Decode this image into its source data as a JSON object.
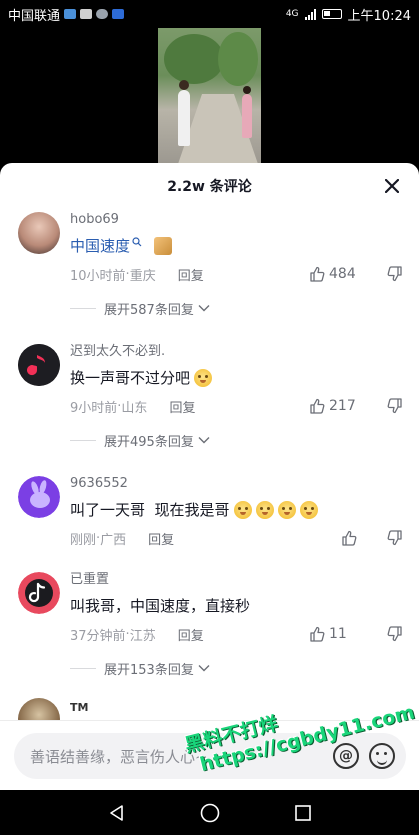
{
  "status_bar": {
    "carrier": "中国联通",
    "network": "4G",
    "time": "上午10:24"
  },
  "sheet": {
    "title": "2.2w 条评论",
    "close_icon": "close-icon"
  },
  "comments": [
    {
      "username": "hobo69",
      "text": "中国速度",
      "text_is_link": true,
      "has_search_icon": true,
      "time": "10小时前",
      "location": "重庆",
      "reply_label": "回复",
      "likes": "484",
      "expand_label": "展开587条回复"
    },
    {
      "username": "迟到太久不必到.",
      "text": "换一声哥不过分吧",
      "emoji_count": 1,
      "time": "9小时前",
      "location": "山东",
      "reply_label": "回复",
      "likes": "217",
      "expand_label": "展开495条回复"
    },
    {
      "username": "9636552",
      "text": "叫了一天哥  现在我是哥",
      "emoji_count": 4,
      "time": "刚刚",
      "location": "广西",
      "reply_label": "回复",
      "likes": ""
    },
    {
      "username": "已重置",
      "text": "叫我哥，中国速度，直接秒",
      "time": "37分钟前",
      "location": "江苏",
      "reply_label": "回复",
      "likes": "11",
      "expand_label": "展开153条回复"
    },
    {
      "username": "TM"
    }
  ],
  "meta_separator": " · ",
  "input": {
    "placeholder": "善语结善缘，恶言伤人心~"
  },
  "watermark": {
    "line1": "黑料不打烊",
    "line2": "https://cgbdy11.com"
  },
  "colors": {
    "link_blue": "#2a5db0",
    "watermark_green": "#19d57a"
  }
}
